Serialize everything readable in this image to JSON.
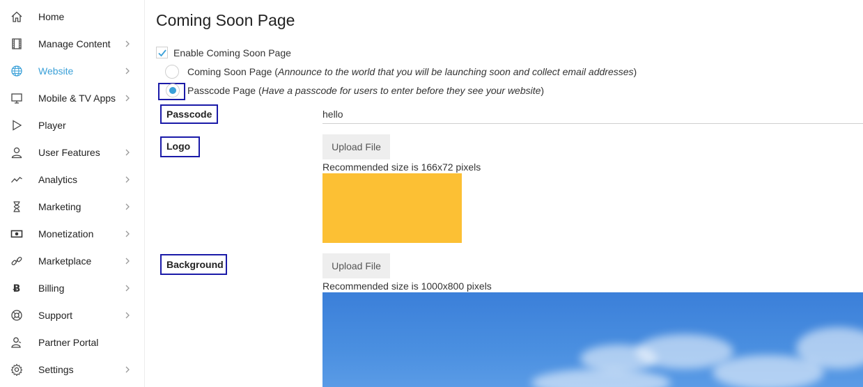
{
  "sidebar": {
    "items": [
      {
        "label": "Home",
        "icon": "home-icon",
        "chevron": false,
        "active": false
      },
      {
        "label": "Manage Content",
        "icon": "film-icon",
        "chevron": true,
        "active": false
      },
      {
        "label": "Website",
        "icon": "globe-icon",
        "chevron": true,
        "active": true
      },
      {
        "label": "Mobile & TV Apps",
        "icon": "monitor-icon",
        "chevron": true,
        "active": false
      },
      {
        "label": "Player",
        "icon": "play-icon",
        "chevron": false,
        "active": false
      },
      {
        "label": "User Features",
        "icon": "user-icon",
        "chevron": true,
        "active": false
      },
      {
        "label": "Analytics",
        "icon": "trend-icon",
        "chevron": true,
        "active": false
      },
      {
        "label": "Marketing",
        "icon": "hourglass-icon",
        "chevron": true,
        "active": false
      },
      {
        "label": "Monetization",
        "icon": "money-icon",
        "chevron": true,
        "active": false
      },
      {
        "label": "Marketplace",
        "icon": "link-icon",
        "chevron": true,
        "active": false
      },
      {
        "label": "Billing",
        "icon": "bitcoin-icon",
        "chevron": true,
        "active": false
      },
      {
        "label": "Support",
        "icon": "lifebuoy-icon",
        "chevron": true,
        "active": false
      },
      {
        "label": "Partner Portal",
        "icon": "partner-icon",
        "chevron": false,
        "active": false
      },
      {
        "label": "Settings",
        "icon": "gear-icon",
        "chevron": true,
        "active": false
      }
    ]
  },
  "main": {
    "title": "Coming Soon Page",
    "enable_label": "Enable Coming Soon Page",
    "enable_checked": true,
    "option_coming_soon": {
      "label": "Coming Soon Page",
      "desc": "Announce to the world that you will be launching soon and collect email addresses",
      "selected": false
    },
    "option_passcode": {
      "label": "Passcode Page",
      "desc": "Have a passcode for users to enter before they see your website",
      "selected": true
    },
    "passcode": {
      "label": "Passcode",
      "value": "hello"
    },
    "logo": {
      "label": "Logo",
      "button": "Upload File",
      "hint": "Recommended size is 166x72 pixels",
      "preview_color": "#fcc034"
    },
    "background": {
      "label": "Background",
      "button": "Upload File",
      "hint": "Recommended size is 1000x800 pixels",
      "preview_color": "#3b7fd9"
    }
  },
  "colors": {
    "accent": "#3aa0d8",
    "highlight_box": "#1a1aa8"
  }
}
